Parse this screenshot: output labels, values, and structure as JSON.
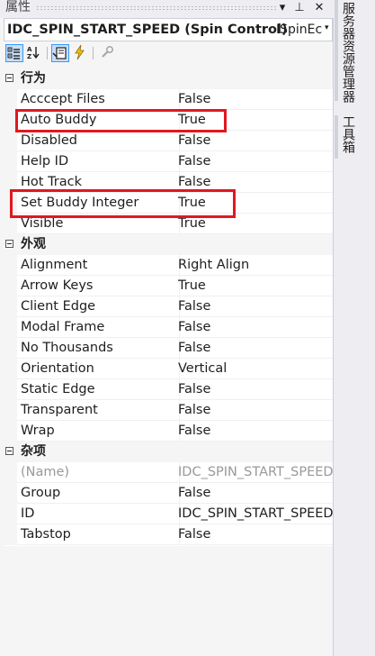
{
  "window": {
    "title": "属性",
    "dropdown_glyph": "▾",
    "pin_glyph": "⊥",
    "close_glyph": "✕"
  },
  "object_selector": {
    "name": "IDC_SPIN_START_SPEED (Spin Control)",
    "type": "ISpinEc",
    "dropdown_glyph": "▾"
  },
  "toolbar": {
    "tools": [
      "categorized-view",
      "alphabetical-view",
      "properties",
      "events",
      "property-pages"
    ],
    "active": [
      "categorized-view",
      "properties"
    ]
  },
  "categories": [
    {
      "label": "行为",
      "rows": [
        {
          "name": "Acccept Files",
          "value": "False"
        },
        {
          "name": "Auto Buddy",
          "value": "True"
        },
        {
          "name": "Disabled",
          "value": "False"
        },
        {
          "name": "Help ID",
          "value": "False"
        },
        {
          "name": "Hot Track",
          "value": "False"
        },
        {
          "name": "Set Buddy Integer",
          "value": "True"
        },
        {
          "name": "Visible",
          "value": "True"
        }
      ]
    },
    {
      "label": "外观",
      "rows": [
        {
          "name": "Alignment",
          "value": "Right Align"
        },
        {
          "name": "Arrow Keys",
          "value": "True"
        },
        {
          "name": "Client Edge",
          "value": "False"
        },
        {
          "name": "Modal Frame",
          "value": "False"
        },
        {
          "name": "No Thousands",
          "value": "False"
        },
        {
          "name": "Orientation",
          "value": "Vertical"
        },
        {
          "name": "Static Edge",
          "value": "False"
        },
        {
          "name": "Transparent",
          "value": "False"
        },
        {
          "name": "Wrap",
          "value": "False"
        }
      ]
    },
    {
      "label": "杂项",
      "rows": [
        {
          "name": "(Name)",
          "value": "IDC_SPIN_START_SPEED",
          "readonly": true
        },
        {
          "name": "Group",
          "value": "False"
        },
        {
          "name": "ID",
          "value": "IDC_SPIN_START_SPEED"
        },
        {
          "name": "Tabstop",
          "value": "False"
        }
      ]
    }
  ],
  "highlighted_properties": [
    "Auto Buddy",
    "Set Buddy Integer"
  ],
  "side_tabs": [
    "服务器资源管理器",
    "工具箱"
  ],
  "colors": {
    "highlight_box": "#e0181f",
    "active_tool": "#c9def5",
    "readonly_text": "#999999"
  }
}
